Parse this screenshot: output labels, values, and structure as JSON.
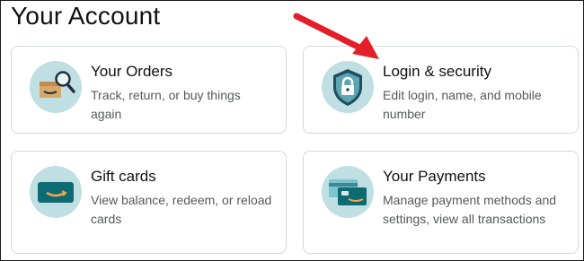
{
  "page": {
    "title": "Your Account"
  },
  "cards": [
    {
      "id": "orders",
      "title": "Your Orders",
      "description": "Track, return, or buy things again",
      "icon": "orders-box-magnifier-icon"
    },
    {
      "id": "login",
      "title": "Login & security",
      "description": "Edit login, name, and mobile number",
      "icon": "shield-lock-icon"
    },
    {
      "id": "gift",
      "title": "Gift cards",
      "description": "View balance, redeem, or reload cards",
      "icon": "gift-card-icon"
    },
    {
      "id": "payments",
      "title": "Your Payments",
      "description": "Manage payment methods and settings, view all transactions",
      "icon": "payment-cards-icon"
    }
  ],
  "colors": {
    "icon_circle": "#bfdfe3",
    "card_border": "#d5d9d9",
    "annotation_arrow": "#e3202a",
    "amazon_orange": "#f3a847",
    "gift_card_teal": "#0f6b73",
    "shield_dark": "#1f4e5f"
  },
  "annotation": {
    "type": "arrow",
    "points_to": "login"
  }
}
